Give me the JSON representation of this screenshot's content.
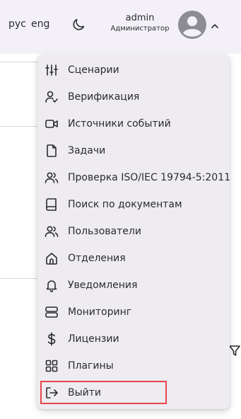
{
  "header": {
    "lang_ru": "рус",
    "lang_en": "eng",
    "user_name": "admin",
    "user_role": "Администратор"
  },
  "menu": {
    "items": [
      {
        "label": "Сценарии",
        "icon": "sliders-icon"
      },
      {
        "label": "Верификация",
        "icon": "user-check-icon"
      },
      {
        "label": "Источники событий",
        "icon": "video-icon"
      },
      {
        "label": "Задачи",
        "icon": "file-icon"
      },
      {
        "label": "Проверка ISO/IEC 19794-5:2011",
        "icon": "users-icon"
      },
      {
        "label": "Поиск по документам",
        "icon": "book-icon"
      },
      {
        "label": "Пользователи",
        "icon": "users-icon"
      },
      {
        "label": "Отделения",
        "icon": "home-icon"
      },
      {
        "label": "Уведомления",
        "icon": "bell-icon"
      },
      {
        "label": "Мониторинг",
        "icon": "server-icon"
      },
      {
        "label": "Лицензии",
        "icon": "dollar-icon"
      },
      {
        "label": "Плагины",
        "icon": "grid-icon"
      },
      {
        "label": "Выйти",
        "icon": "logout-icon"
      }
    ]
  },
  "colors": {
    "header_bg": "#f3f1f7",
    "menu_bg": "#eeecf1",
    "highlight_border": "#e5464c",
    "avatar": "#8e8c93"
  }
}
